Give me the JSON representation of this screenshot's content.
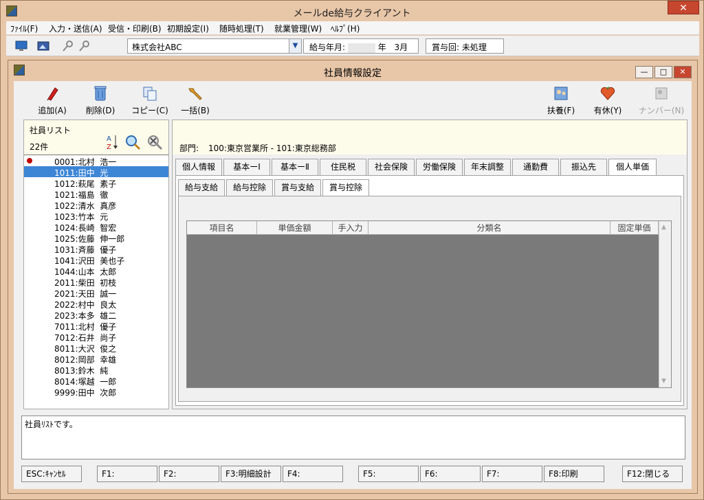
{
  "app": {
    "title": "メールde給与クライアント"
  },
  "menu": [
    "ﾌｧｲﾙ(F)",
    "入力・送信(A)",
    "受信・印刷(B)",
    "初期設定(I)",
    "随時処理(T)",
    "就業管理(W)",
    "ﾍﾙﾌﾟ(H)"
  ],
  "toolbar": {
    "company": "株式会社ABC",
    "pay_month_label": "給与年月:",
    "pay_month_year": "年",
    "pay_month_value": "3月",
    "bonus_label": "賞与回: 未処理"
  },
  "subwindow": {
    "title": "社員情報設定"
  },
  "actions": {
    "add": "追加(A)",
    "delete": "削除(D)",
    "copy": "コピー(C)",
    "bulk": "一括(B)",
    "dependents": "扶養(F)",
    "paid_leave": "有休(Y)",
    "number": "ナンバー(N)"
  },
  "employees": {
    "title": "社員リスト",
    "count": "22件",
    "items": [
      {
        "code": "0001:北村",
        "name": "浩一"
      },
      {
        "code": "1011:田中",
        "name": "光"
      },
      {
        "code": "1012:萩尾",
        "name": "素子"
      },
      {
        "code": "1021:福島",
        "name": "徹"
      },
      {
        "code": "1022:清水",
        "name": "真彦"
      },
      {
        "code": "1023:竹本",
        "name": "元"
      },
      {
        "code": "1024:長崎",
        "name": "智宏"
      },
      {
        "code": "1025:佐藤",
        "name": "伸一郎"
      },
      {
        "code": "1031:斉藤",
        "name": "優子"
      },
      {
        "code": "1041:沢田",
        "name": "美也子"
      },
      {
        "code": "1044:山本",
        "name": "太郎"
      },
      {
        "code": "2011:柴田",
        "name": "初枝"
      },
      {
        "code": "2021:天田",
        "name": "誠一"
      },
      {
        "code": "2022:村中",
        "name": "良太"
      },
      {
        "code": "2023:本多",
        "name": "雄二"
      },
      {
        "code": "7011:北村",
        "name": "優子"
      },
      {
        "code": "7012:石井",
        "name": "尚子"
      },
      {
        "code": "8011:大沢",
        "name": "俊之"
      },
      {
        "code": "8012:岡部",
        "name": "幸雄"
      },
      {
        "code": "8013:鈴木",
        "name": "純"
      },
      {
        "code": "8014:塚越",
        "name": "一郎"
      },
      {
        "code": "9999:田中",
        "name": "次郎"
      }
    ]
  },
  "department": {
    "label": "部門:",
    "value": "100:東京営業所 - 101:東京総務部"
  },
  "tabs": [
    "個人情報",
    "基本ーⅠ",
    "基本ーⅡ",
    "住民税",
    "社会保険",
    "労働保険",
    "年末調整",
    "通勤費",
    "振込先",
    "個人単価"
  ],
  "subtabs": [
    "給与支給",
    "給与控除",
    "賞与支給",
    "賞与控除"
  ],
  "grid": {
    "columns": [
      "項目名",
      "単価金額",
      "手入力",
      "分類名",
      "固定単価"
    ]
  },
  "status": {
    "message": "社員ﾘｽﾄです。"
  },
  "fkeys": [
    "ESC:ｷｬﾝｾﾙ",
    "F1:",
    "F2:",
    "F3:明細設計",
    "F4:",
    "F5:",
    "F6:",
    "F7:",
    "F8:印刷",
    "F12:閉じる"
  ]
}
